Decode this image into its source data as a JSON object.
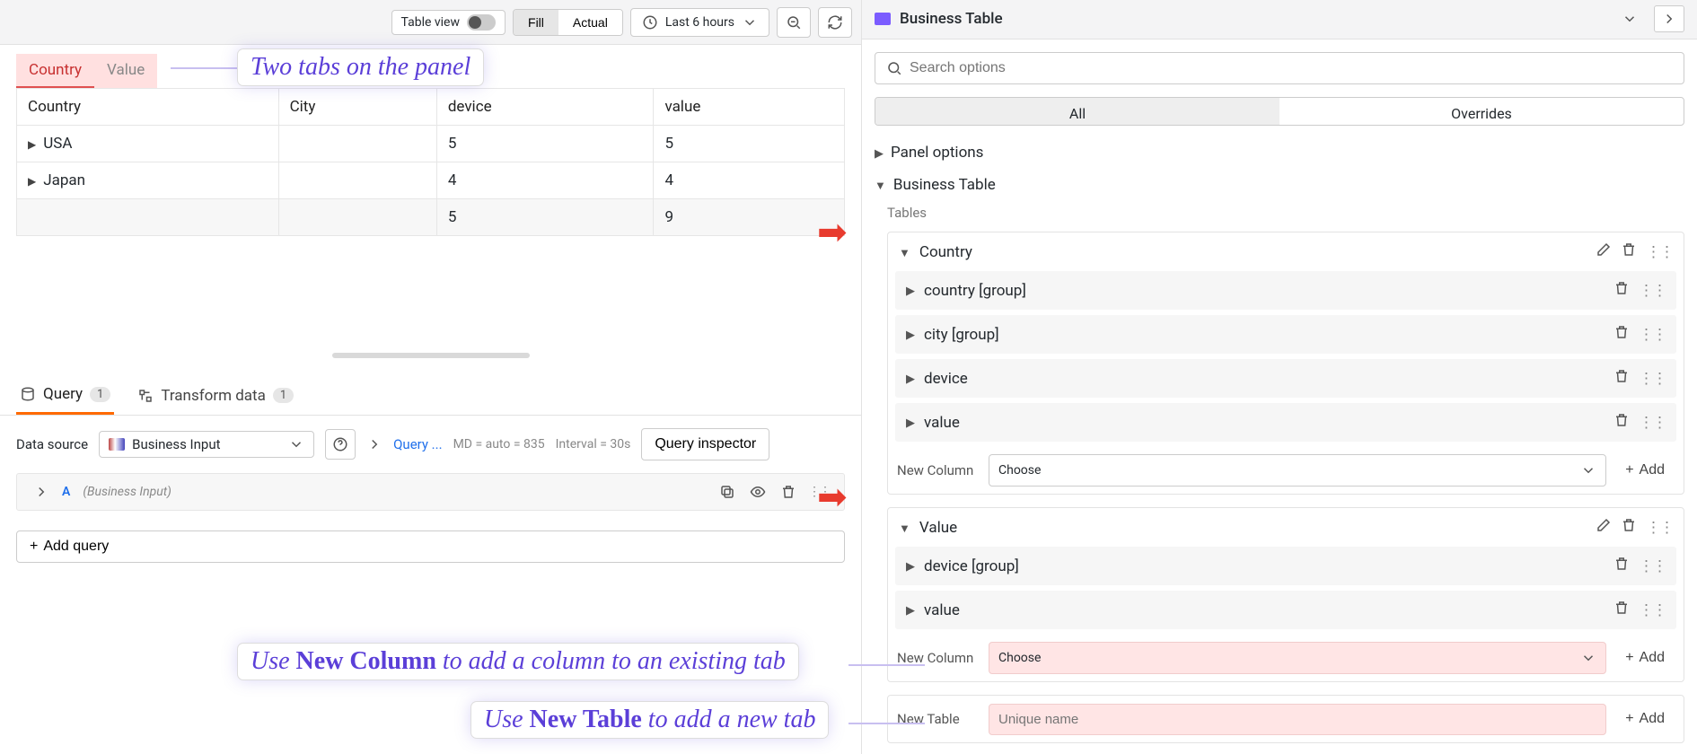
{
  "toolbar": {
    "table_view_label": "Table view",
    "fill_label": "Fill",
    "actual_label": "Actual",
    "timerange_label": "Last 6 hours"
  },
  "panel_tabs": {
    "country": "Country",
    "value": "Value"
  },
  "table": {
    "headers": [
      "Country",
      "City",
      "device",
      "value"
    ],
    "rows": [
      {
        "country": "USA",
        "city": "",
        "device": "5",
        "value": "5"
      },
      {
        "country": "Japan",
        "city": "",
        "device": "4",
        "value": "4"
      }
    ],
    "footer": {
      "country": "",
      "city": "",
      "device": "5",
      "value": "9"
    }
  },
  "query_tabs": {
    "query_label": "Query",
    "query_count": "1",
    "transform_label": "Transform data",
    "transform_count": "1"
  },
  "ds": {
    "label": "Data source",
    "name": "Business Input",
    "query_link": "Query ...",
    "md": "MD = auto = 835",
    "interval": "Interval = 30s",
    "inspector": "Query inspector"
  },
  "query_row": {
    "letter": "A",
    "src": "(Business Input)"
  },
  "add_query_label": "Add query",
  "annotations": {
    "a1": "Two tabs on the panel",
    "a2_pre": "Use ",
    "a2_b": "New Column",
    "a2_post": " to add a column to an existing tab",
    "a3_pre": "Use ",
    "a3_b": "New Table",
    "a3_post": " to add a new tab"
  },
  "right": {
    "header": "Business Table",
    "search_placeholder": "Search options",
    "tab_all": "All",
    "tab_overrides": "Overrides",
    "sec_panel_options": "Panel options",
    "sec_business_table": "Business Table",
    "tables_label": "Tables",
    "new_column_label": "New Column",
    "choose_label": "Choose",
    "new_table_label": "New Table",
    "unique_name_placeholder": "Unique name",
    "add_label": "Add",
    "country_card": {
      "title": "Country",
      "cols": [
        "country [group]",
        "city [group]",
        "device",
        "value"
      ]
    },
    "value_card": {
      "title": "Value",
      "cols": [
        "device [group]",
        "value"
      ]
    }
  }
}
